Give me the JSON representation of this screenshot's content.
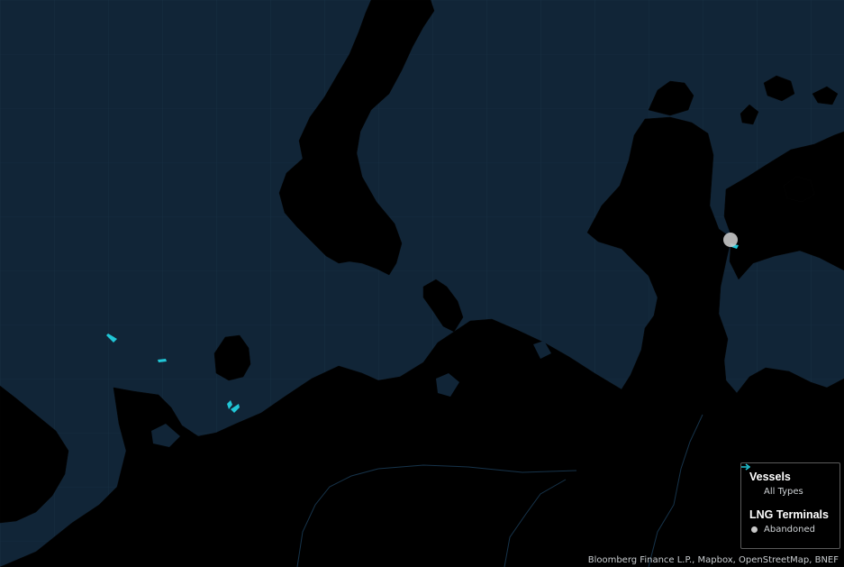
{
  "map": {
    "background_color": "#112537",
    "land_color": "#000000",
    "vessel_color": "#21c6d6",
    "terminal_color": "#c6c6c6"
  },
  "markers": {
    "vessels": [
      {
        "icon": "vessel-icon",
        "type": "All Types"
      },
      {
        "icon": "vessel-icon",
        "type": "All Types"
      },
      {
        "icon": "vessel-icon",
        "type": "All Types"
      },
      {
        "icon": "vessel-icon",
        "type": "All Types"
      },
      {
        "icon": "vessel-icon",
        "type": "All Types"
      }
    ],
    "terminals": [
      {
        "icon": "terminal-dot-icon",
        "status": "Abandoned"
      }
    ]
  },
  "legend": {
    "vessels_title": "Vessels",
    "vessels_item": "All Types",
    "terminals_title": "LNG Terminals",
    "terminals_item": "Abandoned"
  },
  "attribution": "Bloomberg Finance L.P., Mapbox, OpenStreetMap, BNEF"
}
